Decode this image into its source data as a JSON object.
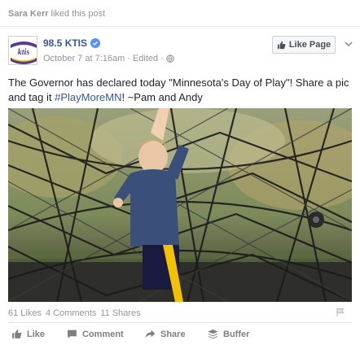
{
  "story": {
    "actor": "Sara Kerr",
    "activity": "liked this post"
  },
  "post": {
    "page_name": "98.5 KTIS",
    "timestamp": "October 7 at 7:16am",
    "edited_label": "Edited",
    "meta_separator": "·",
    "like_page_label": "Like Page",
    "text_before_quote": "The Governor has declared today ",
    "quoted": "\"Minnesota's Day of Play\"",
    "text_after_quote": "! Share a pic and tag it ",
    "hashtag": "#PlayMoreMN",
    "text_end": "! ~Pam and Andy",
    "avatar_text": "ktis"
  },
  "stats": {
    "likes": "61 Likes",
    "comments": "4 Comments",
    "shares": "11 Shares"
  },
  "actions": {
    "like": "Like",
    "comment": "Comment",
    "share": "Share",
    "buffer": "Buffer"
  },
  "colors": {
    "link": "#365899",
    "muted": "#90949c",
    "verified": "#5890ff",
    "ktis_purple": "#5b3a8c"
  },
  "icons": [
    "verified-badge-icon",
    "globe-icon",
    "thumbs-up-icon",
    "chevron-down-icon",
    "flag-icon",
    "like-icon",
    "comment-icon",
    "share-icon",
    "buffer-icon"
  ]
}
